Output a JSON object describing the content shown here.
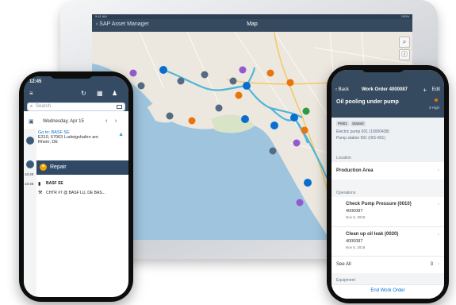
{
  "tablet": {
    "status_time": "9:41 AM",
    "status_right": "100%",
    "back_label": "SAP Asset Manager",
    "title": "Map"
  },
  "left_phone": {
    "time": "12:45",
    "search_placeholder": "Search",
    "date": "Wednesday, Apr 15",
    "card1": {
      "line1": "Go to: BASF SE",
      "line2": "E310, 67063 Ludwigshafen am",
      "line3": "Rhein, DE"
    },
    "times": [
      "10:40",
      "10:45"
    ],
    "repair_label": "Repair",
    "card2": {
      "line1": "BASF SE",
      "line2": "CHTR #7 @ BASF LU, DE BAS..."
    }
  },
  "right_phone": {
    "back_label": "Back",
    "title": "Work Order 4000087",
    "edit_label": "Edit",
    "order_title": "Oil pooling under pump",
    "priority": "3-High",
    "chips": [
      "PM01",
      "Started"
    ],
    "equipment_line": "Electric pump 001 (10000438)",
    "station_line": "Pump station 001 (001-801)",
    "location_caption": "Location",
    "location_value": "Production Area",
    "operations_caption": "Operations",
    "op1": {
      "title": "Check Pump Pressure (0010)",
      "order": "4000087",
      "date": "Nov 5, 2018"
    },
    "op2": {
      "title": "Clean up oil leak (0020)",
      "order": "4000087",
      "date": "Nov 5, 2018"
    },
    "see_all": "See All",
    "see_all_count": "3",
    "equipment_caption": "Equipment",
    "end_button": "End Work Order"
  },
  "colors": {
    "shell_blue": "#354a5f",
    "accent_blue": "#0a6ed1",
    "route_cyan": "#4fb6d8",
    "marker_orange": "#e9730c",
    "marker_purple": "#925ace",
    "marker_gray": "#556b82"
  }
}
